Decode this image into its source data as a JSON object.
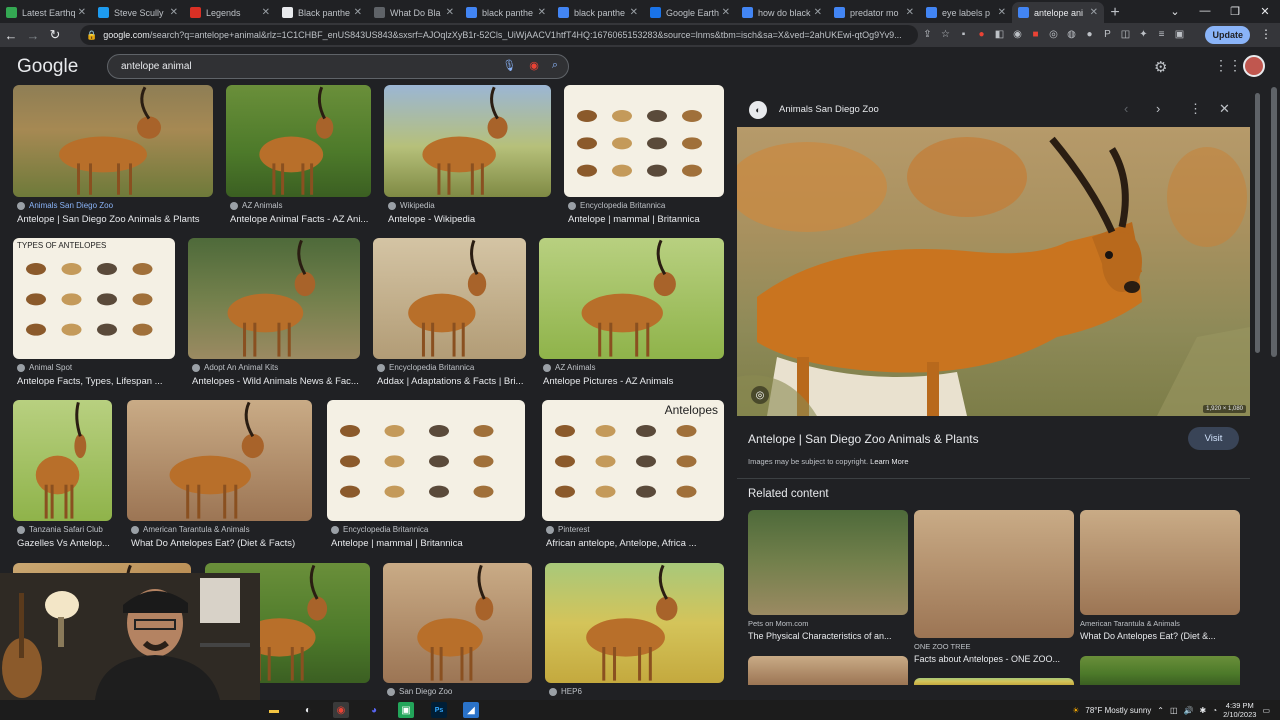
{
  "browser": {
    "tabs": [
      {
        "label": "Latest Earthq",
        "fav_color": "#34a853",
        "active": false
      },
      {
        "label": "Steve Scully",
        "fav_color": "#1d9bf0",
        "active": false
      },
      {
        "label": "Legends",
        "fav_color": "#d93025",
        "active": false
      },
      {
        "label": "Black panthe",
        "fav_color": "#e8eaed",
        "active": false
      },
      {
        "label": "What Do Bla",
        "fav_color": "#5f6368",
        "active": false
      },
      {
        "label": "black panthe",
        "fav_color": "#4285f4",
        "active": false
      },
      {
        "label": "black panthe",
        "fav_color": "#4285f4",
        "active": false
      },
      {
        "label": "Google Earth",
        "fav_color": "#1a73e8",
        "active": false
      },
      {
        "label": "how do black",
        "fav_color": "#4285f4",
        "active": false
      },
      {
        "label": "predator mo",
        "fav_color": "#4285f4",
        "active": false
      },
      {
        "label": "eye labels p",
        "fav_color": "#4285f4",
        "active": false
      },
      {
        "label": "antelope ani",
        "fav_color": "#4285f4",
        "active": true
      }
    ],
    "url_domain": "google.com",
    "url_rest": "/search?q=antelope+animal&rlz=1C1CHBF_enUS843US843&sxsrf=AJOqlzXyB1r-52Cls_UiWjAACV1htfT4HQ:1676065153283&source=lnms&tbm=isch&sa=X&ved=2ahUKEwi-qtOg9Yv9...",
    "update_label": "Update"
  },
  "google": {
    "logo": "Google",
    "query": "antelope animal"
  },
  "results": [
    {
      "source": "Animals San Diego Zoo",
      "title": "Antelope | San Diego Zoo Animals & Plants",
      "source_color": "#8ab4f8",
      "style": "img-savanna"
    },
    {
      "source": "AZ Animals",
      "title": "Antelope Animal Facts - AZ Ani...",
      "source_color": "#bdc1c6",
      "style": "img-green"
    },
    {
      "source": "Wikipedia",
      "title": "Antelope - Wikipedia",
      "source_color": "#bdc1c6",
      "style": "img-sky"
    },
    {
      "source": "Encyclopedia Britannica",
      "title": "Antelope | mammal | Britannica",
      "source_color": "#bdc1c6",
      "style": "img-chart"
    },
    {
      "source": "Animal Spot",
      "title": "Antelope Facts, Types, Lifespan ...",
      "source_color": "#bdc1c6",
      "style": "img-chart",
      "overlay": "TYPES OF ANTELOPES"
    },
    {
      "source": "Adopt An Animal Kits",
      "title": "Antelopes - Wild Animals News & Fac...",
      "source_color": "#bdc1c6",
      "style": "img-dark"
    },
    {
      "source": "Encyclopedia Britannica",
      "title": "Addax | Adaptations & Facts | Bri...",
      "source_color": "#bdc1c6",
      "style": "img-sand"
    },
    {
      "source": "AZ Animals",
      "title": "Antelope Pictures - AZ Animals",
      "source_color": "#bdc1c6",
      "style": "img-lime"
    },
    {
      "source": "Tanzania Safari Club",
      "title": "Gazelles Vs Antelop...",
      "source_color": "#bdc1c6",
      "style": "img-lime"
    },
    {
      "source": "American Tarantula & Animals",
      "title": "What Do Antelopes Eat? (Diet & Facts)",
      "source_color": "#bdc1c6",
      "style": "img-warm"
    },
    {
      "source": "Encyclopedia Britannica",
      "title": "Antelope | mammal | Britannica",
      "source_color": "#bdc1c6",
      "style": "img-chart"
    },
    {
      "source": "Pinterest",
      "title": "African antelope, Antelope, Africa ...",
      "source_color": "#bdc1c6",
      "style": "img-chart",
      "overlay": "Antelopes"
    },
    {
      "source": "",
      "title": "",
      "source_color": "#bdc1c6",
      "style": "img-tan"
    },
    {
      "source": "",
      "title": "",
      "source_color": "#bdc1c6",
      "style": "img-green"
    },
    {
      "source": "San Diego Zoo",
      "title": "",
      "source_color": "#bdc1c6",
      "style": "img-warm"
    },
    {
      "source": "HEP6",
      "title": "",
      "source_color": "#bdc1c6",
      "style": "img-grass"
    }
  ],
  "preview": {
    "source": "Animals San Diego Zoo",
    "title": "Antelope | San Diego Zoo Animals & Plants",
    "dims": "1,920 × 1,080",
    "visit_label": "Visit",
    "copyright": "Images may be subject to copyright.",
    "learn_more": "Learn More",
    "related_heading": "Related content",
    "related": [
      {
        "source": "Pets on Mom.com",
        "title": "The Physical Characteristics of an...",
        "style": "img-dark"
      },
      {
        "source": "ONE ZOO TREE",
        "title": "Facts about Antelopes - ONE ZOO...",
        "style": "img-warm"
      },
      {
        "source": "American Tarantula & Animals",
        "title": "What Do Antelopes Eat? (Diet &...",
        "style": "img-warm"
      }
    ]
  },
  "taskbar": {
    "weather": "78°F  Mostly sunny",
    "time": "4:39 PM",
    "date": "2/10/2023"
  }
}
